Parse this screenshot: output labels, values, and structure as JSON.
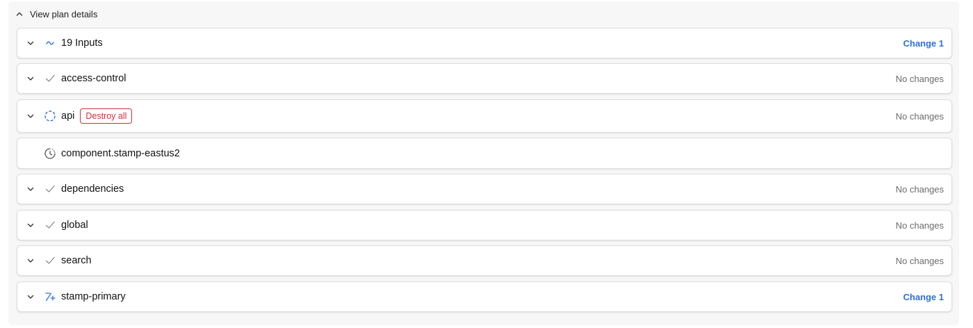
{
  "toggle": {
    "label": "View plan details",
    "icon": "chevron-up-icon"
  },
  "rows": [
    {
      "name": "19 Inputs",
      "icon": "tilde-icon",
      "status": "Change 1",
      "status_kind": "change"
    },
    {
      "name": "access-control",
      "icon": "check-icon",
      "status": "No changes",
      "status_kind": "nochange"
    },
    {
      "name": "api",
      "icon": "loading-spinner-icon",
      "badge": "Destroy all",
      "status": "No changes",
      "status_kind": "nochange"
    },
    {
      "name": "component.stamp-eastus2",
      "icon": "clock-icon"
    },
    {
      "name": "dependencies",
      "icon": "check-icon",
      "status": "No changes",
      "status_kind": "nochange"
    },
    {
      "name": "global",
      "icon": "check-icon",
      "status": "No changes",
      "status_kind": "nochange"
    },
    {
      "name": "search",
      "icon": "check-icon",
      "status": "No changes",
      "status_kind": "nochange"
    },
    {
      "name": "stamp-primary",
      "icon": "diff-icon",
      "status": "Change 1",
      "status_kind": "change"
    }
  ],
  "colors": {
    "change_blue": "#2f6fd8",
    "destroy_red": "#d0303a",
    "muted_gray": "#6b6b6b",
    "check_gray": "#8a8a8a"
  }
}
